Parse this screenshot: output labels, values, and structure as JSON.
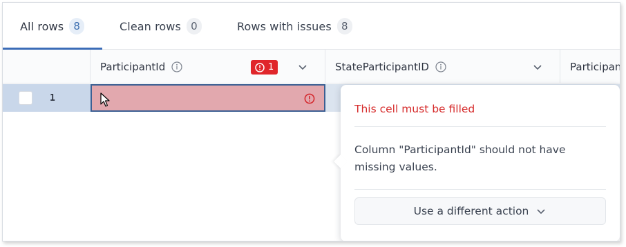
{
  "tabs": [
    {
      "label": "All rows",
      "count": "8",
      "active": true
    },
    {
      "label": "Clean rows",
      "count": "0",
      "active": false
    },
    {
      "label": "Rows with issues",
      "count": "8",
      "active": false
    }
  ],
  "columns": [
    {
      "name": "ParticipantId",
      "error_count": "1"
    },
    {
      "name": "StateParticipantID"
    },
    {
      "name": "Participan"
    }
  ],
  "rows": [
    {
      "number": "1"
    }
  ],
  "popover": {
    "title": "This cell must be filled",
    "message": "Column \"ParticipantId\" should not have missing values.",
    "action_label": "Use a different action"
  },
  "colors": {
    "accent": "#3b6cb7",
    "error": "#e0262b",
    "error_cell_bg": "#e2a8ae",
    "selected_row_bg": "#c9d7ea"
  },
  "icons": [
    "info-icon",
    "chevron-down-icon",
    "alert-circle-icon",
    "mouse-pointer-icon",
    "checkbox"
  ]
}
